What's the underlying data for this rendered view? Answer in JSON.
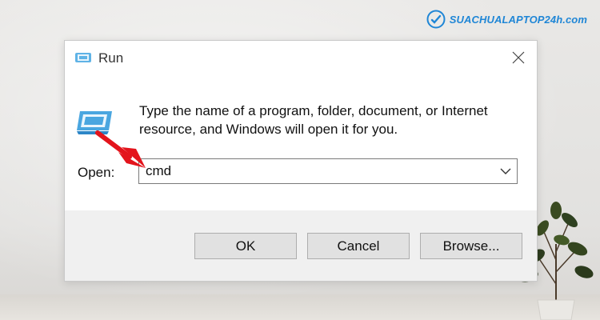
{
  "brand": {
    "text": "SUACHUALAPTOP24h.com"
  },
  "dialog": {
    "title": "Run",
    "description": "Type the name of a program, folder, document, or Internet resource, and Windows will open it for you.",
    "open_label": "Open:",
    "open_value": "cmd",
    "buttons": {
      "ok": "OK",
      "cancel": "Cancel",
      "browse": "Browse..."
    }
  },
  "icons": {
    "title": "run-icon",
    "close": "close-icon",
    "dropdown": "chevron-down-icon",
    "annotation": "red-arrow-icon"
  },
  "colors": {
    "brand": "#1f86d6",
    "arrow": "#e3141c",
    "footer": "#f0f0f0"
  }
}
